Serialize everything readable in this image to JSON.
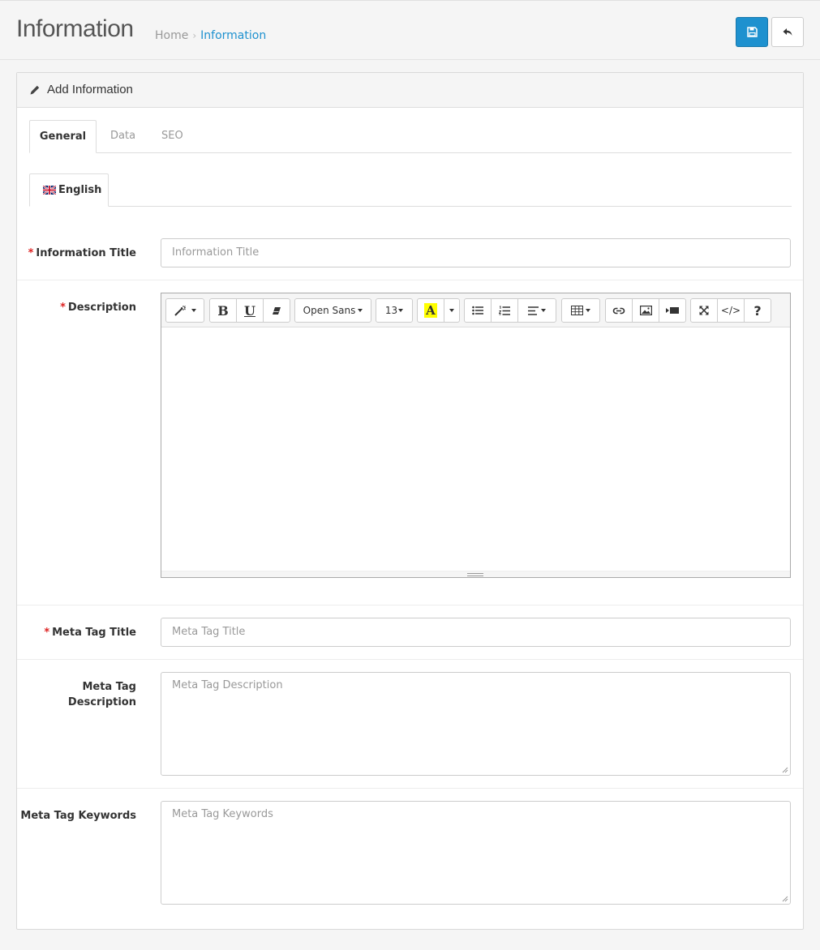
{
  "header": {
    "title": "Information",
    "breadcrumb": {
      "home": "Home",
      "separator": "›",
      "current": "Information"
    },
    "save_icon": "floppy-disk-icon",
    "back_icon": "reply-arrow-icon"
  },
  "panel": {
    "title": "Add Information",
    "icon": "pencil-icon"
  },
  "tabs": [
    {
      "label": "General",
      "active": true
    },
    {
      "label": "Data",
      "active": false
    },
    {
      "label": "SEO",
      "active": false
    }
  ],
  "language_tab": {
    "label": "English",
    "flag": "uk-flag-icon"
  },
  "fields": {
    "title": {
      "label": "Information Title",
      "placeholder": "Information Title",
      "value": "",
      "required": true
    },
    "description": {
      "label": "Description",
      "value": "",
      "required": true
    },
    "meta_title": {
      "label": "Meta Tag Title",
      "placeholder": "Meta Tag Title",
      "value": "",
      "required": true
    },
    "meta_description": {
      "label_line1": "Meta Tag",
      "label_line2": "Description",
      "placeholder": "Meta Tag Description",
      "value": "",
      "required": false
    },
    "meta_keywords": {
      "label": "Meta Tag Keywords",
      "placeholder": "Meta Tag Keywords",
      "value": "",
      "required": false
    }
  },
  "required_marker": "*",
  "editor_toolbar": {
    "bold": "B",
    "underline": "U",
    "font_family": "Open Sans",
    "font_size": "13",
    "font_color": "A",
    "font_color_highlight": "#ffff00",
    "help": "?",
    "code": "</>"
  },
  "colors": {
    "primary": "#1e91cf",
    "required": "#dd2222"
  }
}
